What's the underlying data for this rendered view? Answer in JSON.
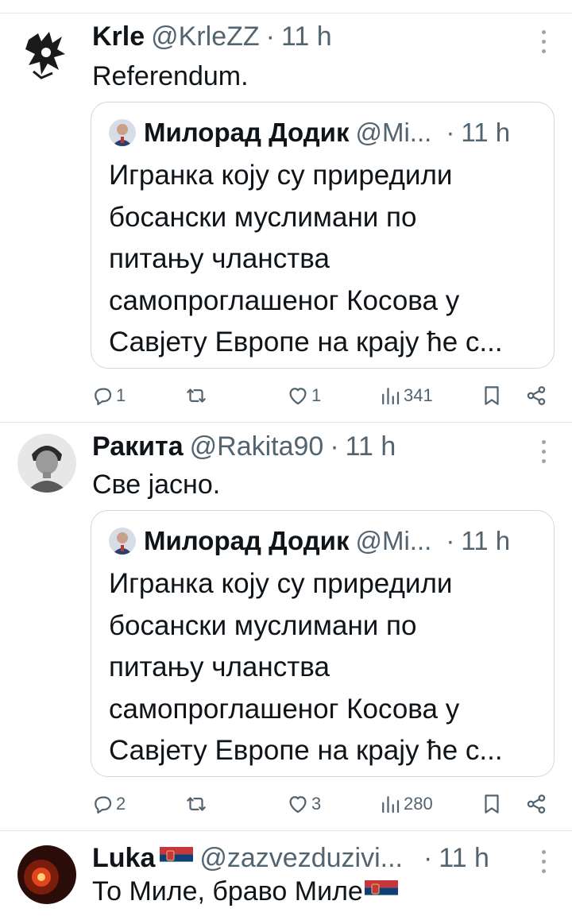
{
  "tweets": [
    {
      "name": "Krle",
      "handle": "@KrleZZ",
      "time": "11 h",
      "text": "Referendum.",
      "quote": {
        "name": "Милорад Додик",
        "handle": "@Mi...",
        "time": "11 h",
        "lines": [
          "Игранка коју су приредили",
          "босански муслимани по",
          "питању чланства",
          "самопроглашеног Косова у",
          "Савјету Европе на крају ће с..."
        ]
      },
      "replies": "1",
      "reposts": "",
      "likes": "1",
      "views": "341"
    },
    {
      "name": "Ракита",
      "handle": "@Rakita90",
      "time": "11 h",
      "text": "Све јасно.",
      "quote": {
        "name": "Милорад Додик",
        "handle": "@Mi...",
        "time": "11 h",
        "lines": [
          "Игранка коју су приредили",
          "босански муслимани по",
          "питању чланства",
          "самопроглашеног Косова у",
          "Савјету Европе на крају ће с..."
        ]
      },
      "replies": "2",
      "reposts": "",
      "likes": "3",
      "views": "280"
    },
    {
      "name": "Luka",
      "handle": "@zazvezduzivi...",
      "time": "11 h",
      "text": "То Миле, браво Миле"
    }
  ],
  "colors": {
    "text": "#0f1419",
    "secondary": "#536471",
    "border": "#cfd9de",
    "divider": "#e6e9ec"
  },
  "icons": {
    "reply": "reply-icon",
    "repost": "repost-icon",
    "like": "heart-icon",
    "views": "views-chart-icon",
    "bookmark": "bookmark-icon",
    "share": "share-icon",
    "more": "more-vertical-icon",
    "flag": "serbia-flag-icon"
  }
}
